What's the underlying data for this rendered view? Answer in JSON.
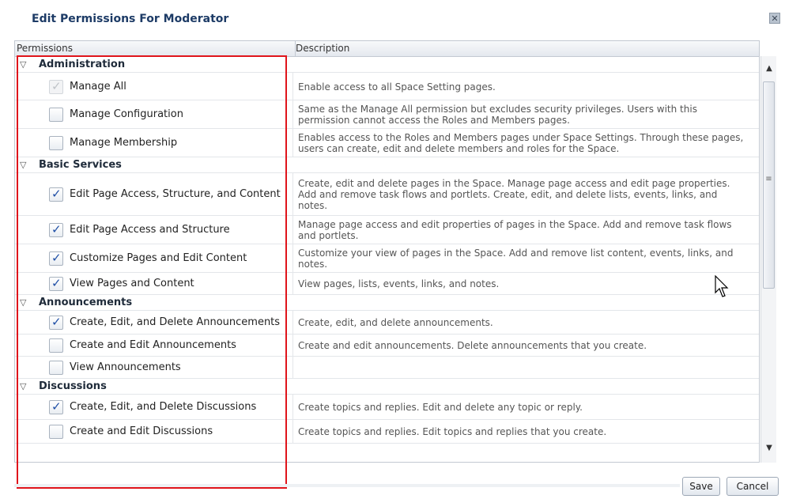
{
  "dialog": {
    "title": "Edit Permissions For Moderator",
    "close_icon": "close-icon"
  },
  "table": {
    "columns": [
      "Permissions",
      "Description"
    ],
    "groups": [
      {
        "name": "Administration",
        "items": [
          {
            "label": "Manage All",
            "checked": true,
            "disabled": true,
            "description": "Enable access to all Space Setting pages."
          },
          {
            "label": "Manage Configuration",
            "checked": false,
            "disabled": false,
            "description": "Same as the Manage All permission but excludes security privileges. Users with this permission cannot access the Roles and Members pages."
          },
          {
            "label": "Manage Membership",
            "checked": false,
            "disabled": false,
            "description": "Enables access to the Roles and Members pages under Space Settings. Through these pages, users can create, edit and delete members and roles for the Space."
          }
        ]
      },
      {
        "name": "Basic Services",
        "items": [
          {
            "label": "Edit Page Access, Structure, and Content",
            "checked": true,
            "disabled": false,
            "description": "Create, edit and delete pages in the Space. Manage page access and edit page properties. Add and remove task flows and portlets. Create, edit, and delete lists, events, links, and notes."
          },
          {
            "label": "Edit Page Access and Structure",
            "checked": true,
            "disabled": false,
            "description": "Manage page access and edit properties of pages in the Space. Add and remove task flows and portlets."
          },
          {
            "label": "Customize Pages and Edit Content",
            "checked": true,
            "disabled": false,
            "description": "Customize your view of pages in the Space. Add and remove list content, events, links, and notes."
          },
          {
            "label": "View Pages and Content",
            "checked": true,
            "disabled": false,
            "description": "View pages, lists, events, links, and notes."
          }
        ]
      },
      {
        "name": "Announcements",
        "items": [
          {
            "label": "Create, Edit, and Delete Announcements",
            "checked": true,
            "disabled": false,
            "description": "Create, edit, and delete announcements."
          },
          {
            "label": "Create and Edit Announcements",
            "checked": false,
            "disabled": false,
            "description": "Create and edit announcements. Delete announcements that you create."
          },
          {
            "label": "View Announcements",
            "checked": false,
            "disabled": false,
            "description": ""
          }
        ]
      },
      {
        "name": "Discussions",
        "items": [
          {
            "label": "Create, Edit, and Delete Discussions",
            "checked": true,
            "disabled": false,
            "description": "Create topics and replies. Edit and delete any topic or reply."
          },
          {
            "label": "Create and Edit Discussions",
            "checked": false,
            "disabled": false,
            "description": "Create topics and replies. Edit topics and replies that you create."
          }
        ]
      }
    ]
  },
  "buttons": {
    "save": "Save",
    "cancel": "Cancel"
  },
  "colors": {
    "title": "#1d3b66",
    "highlight": "#e0141b"
  }
}
